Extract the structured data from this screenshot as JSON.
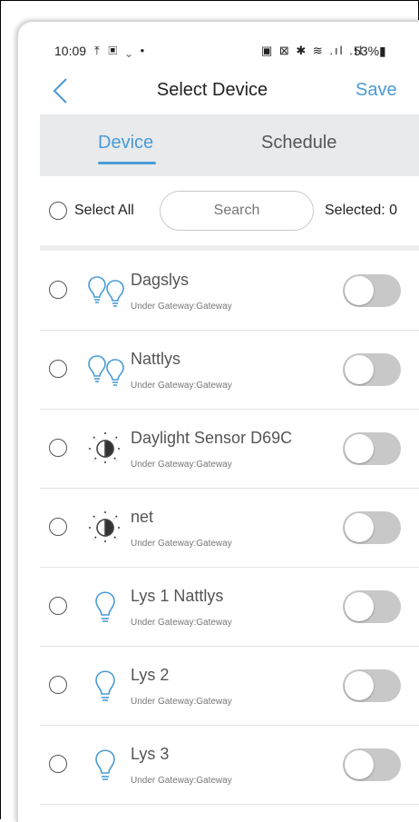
{
  "status_bar": {
    "time": "10:09",
    "left_icons": "⤒ ▣ ⌄ •",
    "right_icons": "▣ ⊠ ✱ ≋ .ıl .ıl",
    "battery": "53%"
  },
  "header": {
    "title": "Select Device",
    "save_label": "Save"
  },
  "tabs": [
    {
      "label": "Device",
      "active": true
    },
    {
      "label": "Schedule",
      "active": false
    }
  ],
  "controls": {
    "select_all_label": "Select All",
    "search_placeholder": "Search",
    "selected_label": "Selected: 0"
  },
  "devices": [
    {
      "name": "Dagslys",
      "subtitle": "Under Gateway:Gateway",
      "icon": "dual-bulb-icon",
      "on": false
    },
    {
      "name": "Nattlys",
      "subtitle": "Under Gateway:Gateway",
      "icon": "dual-bulb-icon",
      "on": false
    },
    {
      "name": "Daylight Sensor D69C",
      "subtitle": "Under Gateway:Gateway",
      "icon": "daylight-sensor-icon",
      "on": false
    },
    {
      "name": "net",
      "subtitle": "Under Gateway:Gateway",
      "icon": "daylight-sensor-icon",
      "on": false
    },
    {
      "name": "Lys 1 Nattlys",
      "subtitle": "Under Gateway:Gateway",
      "icon": "bulb-icon",
      "on": false
    },
    {
      "name": "Lys 2",
      "subtitle": "Under Gateway:Gateway",
      "icon": "bulb-icon",
      "on": false
    },
    {
      "name": "Lys 3",
      "subtitle": "Under Gateway:Gateway",
      "icon": "bulb-icon",
      "on": false
    }
  ],
  "colors": {
    "accent": "#4a9bd6",
    "tab_background": "#e8eaec",
    "toggle_off": "#c8c8c8"
  }
}
